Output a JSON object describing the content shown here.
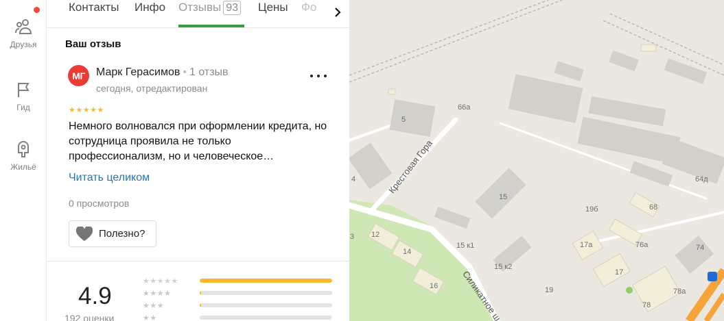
{
  "rail": {
    "items": [
      {
        "label": "Друзья",
        "icon": "friends-icon"
      },
      {
        "label": "Гид",
        "icon": "flag-icon"
      },
      {
        "label": "Жильё",
        "icon": "house-icon"
      }
    ],
    "notification_dot_color": "#ff4433"
  },
  "tabs": {
    "items": [
      {
        "label": "Контакты"
      },
      {
        "label": "Инфо"
      },
      {
        "label": "Отзывы",
        "count": "93",
        "active": true
      },
      {
        "label": "Цены"
      },
      {
        "label": "Фо"
      }
    ],
    "next_icon": "chevron-right-icon",
    "active_color": "#3a9e3f"
  },
  "review": {
    "section_title": "Ваш отзыв",
    "avatar_initials": "МГ",
    "avatar_color": "#ec3a34",
    "author": "Марк Герасимов",
    "author_reviews": "1 отзыв",
    "date": "сегодня, отредактирован",
    "rating": 5,
    "stars": "★★★★★",
    "text": "Немного волновался при оформлении кредита, но сотрудница проявила не только профессионализм, но и человеческое…",
    "read_more": "Читать целиком",
    "views": "0 просмотров",
    "useful_label": "Полезно?",
    "star_color": "#fbb82b"
  },
  "rating_summary": {
    "score": "4.9",
    "count_text": "192 оценки",
    "distribution": [
      {
        "stars": "★★★★★",
        "fraction": 1.0
      },
      {
        "stars": "★★★★",
        "fraction": 0.01
      },
      {
        "stars": "★★★",
        "fraction": 0.01
      },
      {
        "stars": "★★",
        "fraction": 0.0
      }
    ]
  },
  "map": {
    "house_numbers": [
      "5",
      "66а",
      "4",
      "15",
      "15 к1",
      "15 к2",
      "12",
      "14",
      "16",
      "19б",
      "68",
      "64д",
      "17а",
      "76а",
      "74",
      "17",
      "19",
      "78",
      "78а",
      "3"
    ],
    "streets": [
      "Крестовая Гора",
      "Силикатное ш"
    ],
    "metro_icon": "bus-stop-icon"
  }
}
